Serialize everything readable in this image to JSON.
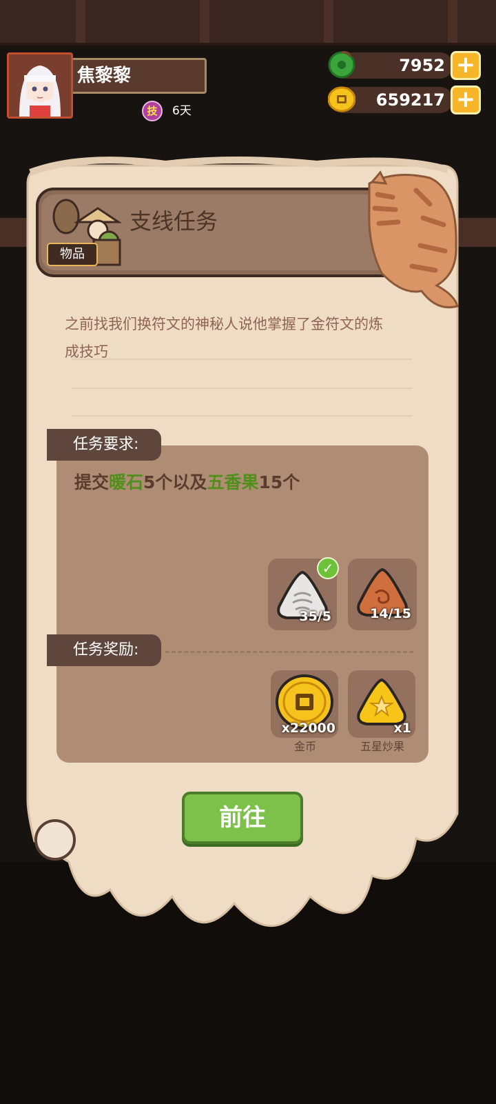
{
  "hud": {
    "player_name": "焦黎黎",
    "skill_badge": "技",
    "days": "6天",
    "jade_value": "7952",
    "coin_value": "659217",
    "plus_symbol": "+"
  },
  "panel": {
    "title": "支线任务",
    "items_tag": "物品",
    "story_line1": "之前找我们换符文的神秘人说他掌握了金符文的炼",
    "story_line2": "成技巧"
  },
  "requirements": {
    "header": "任务要求:",
    "text_prefix": "提交",
    "item1": "暖石",
    "text_mid": "5个以及",
    "item2": "五香果",
    "text_suffix": "15个",
    "slots": [
      {
        "name": "暖石",
        "progress": "35/5",
        "completed": true
      },
      {
        "name": "五香果",
        "progress": "14/15",
        "completed": false
      }
    ]
  },
  "rewards": {
    "header": "任务奖励:",
    "items": [
      {
        "name": "金币",
        "count": "x22000"
      },
      {
        "name": "五星炒果",
        "count": "x1"
      }
    ]
  },
  "go_button": "前往",
  "colors": {
    "accent_green": "#4f8f1a",
    "button_green": "#7ec14a",
    "parchment": "#efdcc5",
    "gold": "#f7b52a"
  }
}
